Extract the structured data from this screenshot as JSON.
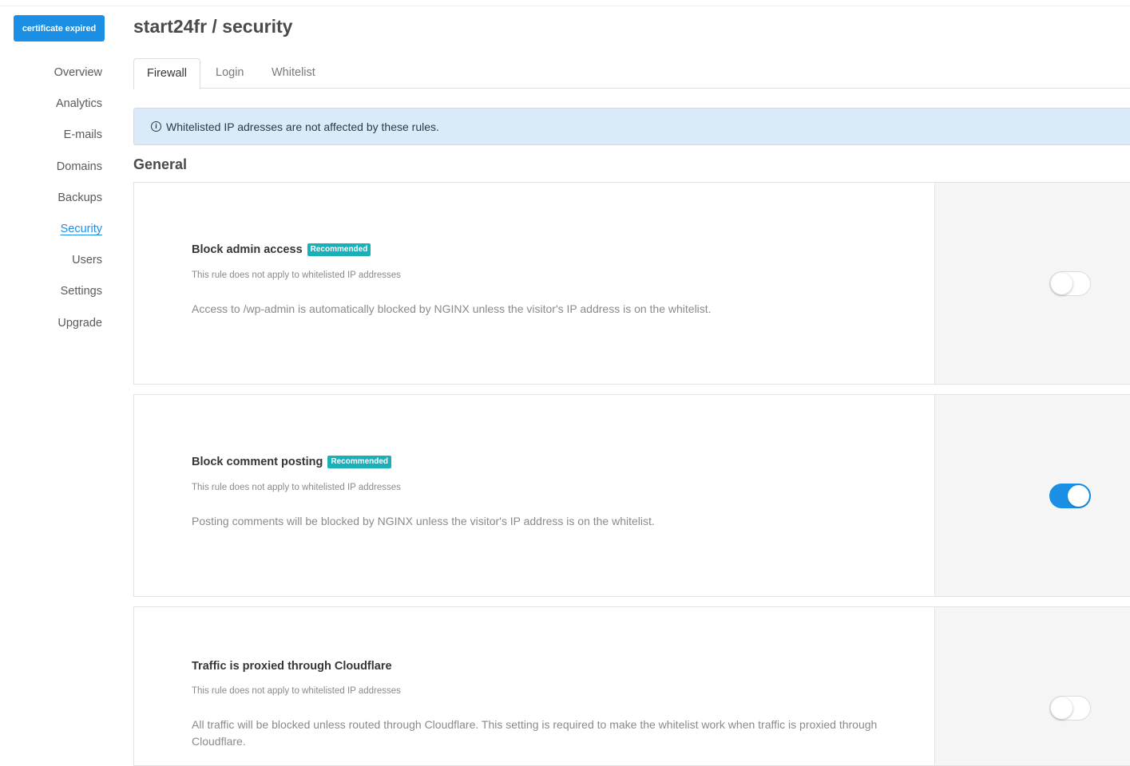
{
  "sidebar": {
    "badge": "certificate expired",
    "items": [
      {
        "label": "Overview",
        "active": false
      },
      {
        "label": "Analytics",
        "active": false
      },
      {
        "label": "E-mails",
        "active": false
      },
      {
        "label": "Domains",
        "active": false
      },
      {
        "label": "Backups",
        "active": false
      },
      {
        "label": "Security",
        "active": true
      },
      {
        "label": "Users",
        "active": false
      },
      {
        "label": "Settings",
        "active": false
      },
      {
        "label": "Upgrade",
        "active": false
      }
    ]
  },
  "header": {
    "title": "start24fr / security"
  },
  "tabs": [
    {
      "label": "Firewall",
      "active": true
    },
    {
      "label": "Login",
      "active": false
    },
    {
      "label": "Whitelist",
      "active": false
    }
  ],
  "banner": {
    "icon": "info-icon",
    "text": "Whitelisted IP adresses are not affected by these rules."
  },
  "section": {
    "title": "General"
  },
  "rules": [
    {
      "title": "Block admin access",
      "tag": "Recommended",
      "subtitle": "This rule does not apply to whitelisted IP addresses",
      "description": "Access to /wp-admin is automatically blocked by NGINX unless the visitor's IP address is on the whitelist.",
      "enabled": false
    },
    {
      "title": "Block comment posting",
      "tag": "Recommended",
      "subtitle": "This rule does not apply to whitelisted IP addresses",
      "description": "Posting comments will be blocked by NGINX unless the visitor's IP address is on the whitelist.",
      "enabled": true
    },
    {
      "title": "Traffic is proxied through Cloudflare",
      "tag": "",
      "subtitle": "This rule does not apply to whitelisted IP addresses",
      "description": "All traffic will be blocked unless routed through Cloudflare. This setting is required to make the whitelist work when traffic is proxied through Cloudflare.",
      "enabled": false
    }
  ],
  "colors": {
    "accent": "#1a8fe3",
    "tag": "#1ab0b8",
    "banner_bg": "#dbeaf8"
  }
}
